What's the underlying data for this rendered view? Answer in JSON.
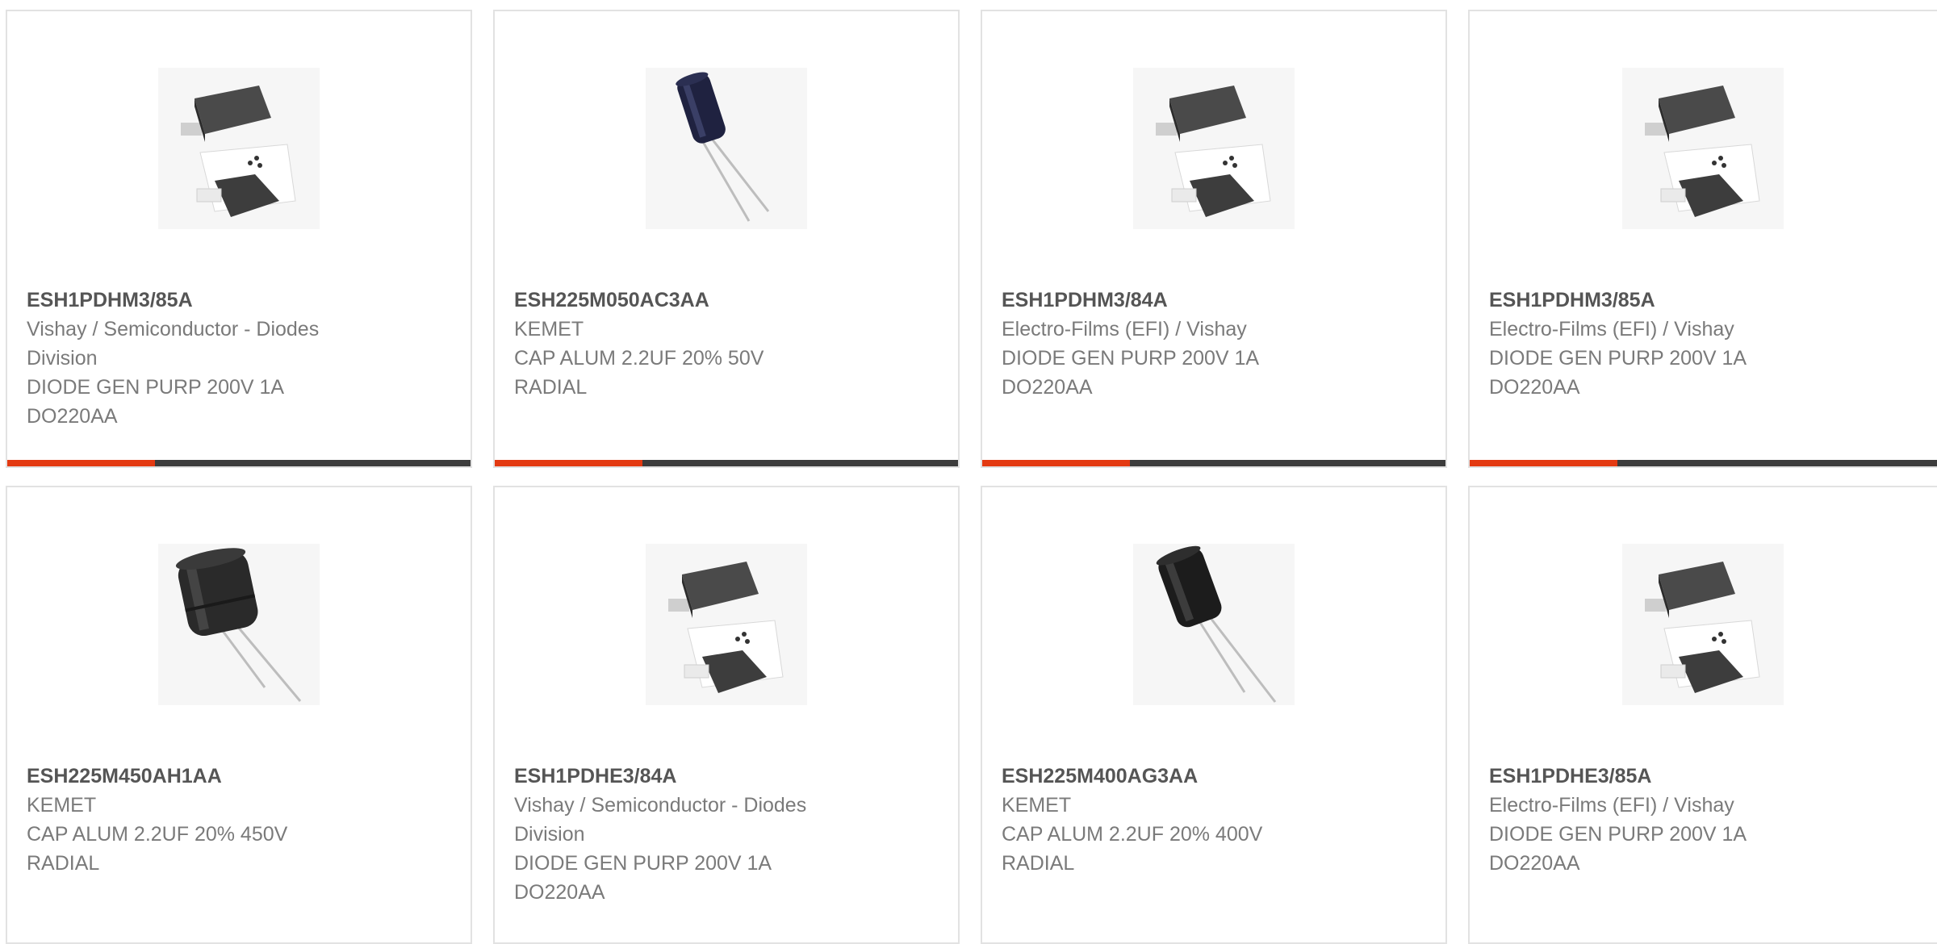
{
  "colors": {
    "accent": "#e33a12",
    "bar_dark": "#3c3c3c",
    "border": "#e2e2e2",
    "title": "#555555",
    "text": "#7a7a7a"
  },
  "products": [
    {
      "part": "ESH1PDHM3/85A",
      "lines": [
        "Vishay / Semiconductor - Diodes",
        "Division",
        "DIODE GEN PURP 200V 1A",
        "DO220AA"
      ],
      "image": "diode-package-image"
    },
    {
      "part": "ESH225M050AC3AA",
      "lines": [
        "KEMET",
        "CAP ALUM 2.2UF 20% 50V",
        "RADIAL"
      ],
      "image": "capacitor-slim-image"
    },
    {
      "part": "ESH1PDHM3/84A",
      "lines": [
        "Electro-Films (EFI) / Vishay",
        "DIODE GEN PURP 200V 1A",
        "DO220AA"
      ],
      "image": "diode-package-image"
    },
    {
      "part": "ESH1PDHM3/85A",
      "lines": [
        "Electro-Films (EFI) / Vishay",
        "DIODE GEN PURP 200V 1A",
        "DO220AA"
      ],
      "image": "diode-package-image"
    },
    {
      "part": "ESH225M450AH1AA",
      "lines": [
        "KEMET",
        "CAP ALUM 2.2UF 20% 450V",
        "RADIAL"
      ],
      "image": "capacitor-wide-image"
    },
    {
      "part": "ESH1PDHE3/84A",
      "lines": [
        "Vishay / Semiconductor - Diodes",
        "Division",
        "DIODE GEN PURP 200V 1A",
        "DO220AA"
      ],
      "image": "diode-package-image"
    },
    {
      "part": "ESH225M400AG3AA",
      "lines": [
        "KEMET",
        "CAP ALUM 2.2UF 20% 400V",
        "RADIAL"
      ],
      "image": "capacitor-medium-image"
    },
    {
      "part": "ESH1PDHE3/85A",
      "lines": [
        "Electro-Films (EFI) / Vishay",
        "DIODE GEN PURP 200V 1A",
        "DO220AA"
      ],
      "image": "diode-package-image"
    }
  ]
}
